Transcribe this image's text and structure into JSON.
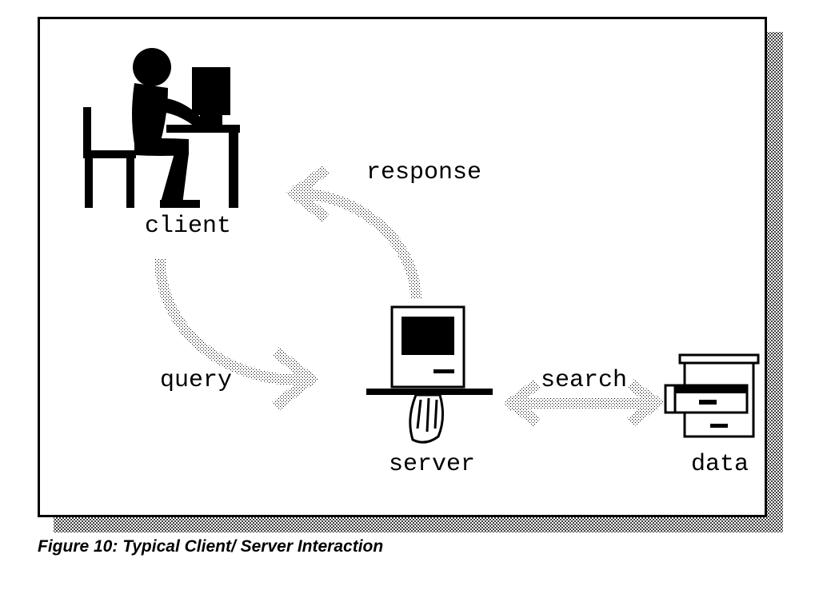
{
  "caption": "Figure 10: Typical Client/ Server Interaction",
  "nodes": {
    "client": "client",
    "server": "server",
    "data": "data"
  },
  "arrows": {
    "query": "query",
    "response": "response",
    "search": "search"
  }
}
